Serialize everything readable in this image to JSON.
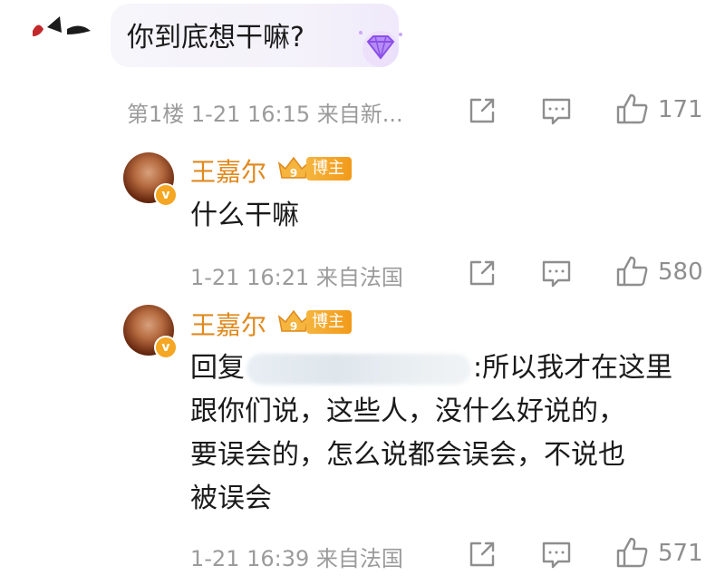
{
  "top_comment": {
    "text": "你到底想干嘛?",
    "meta": "第1楼 1-21 16:15 来自新...",
    "likes": "171"
  },
  "replies": [
    {
      "username": "王嘉尔",
      "badge": "博主",
      "level_badge": "9",
      "verified_mark": "v",
      "text": "什么干嘛",
      "meta": "1-21 16:21 来自法国",
      "likes": "580"
    },
    {
      "username": "王嘉尔",
      "badge": "博主",
      "level_badge": "9",
      "verified_mark": "v",
      "reply_prefix": "回复",
      "text_after_mention": ":所以我才在这里",
      "text_lines": [
        "跟你们说，这些人，没什么好说的，",
        "要误会的，怎么说都会误会，不说也",
        "被误会"
      ],
      "meta": "1-21 16:39 来自法国",
      "likes": "571"
    }
  ],
  "colors": {
    "username": "#e08a1e",
    "meta_text": "#9b9b9b",
    "badge": "#f29a1a"
  },
  "icons": [
    "share-icon",
    "comment-icon",
    "thumbs-up-icon",
    "gem-icon",
    "crown-icon"
  ]
}
